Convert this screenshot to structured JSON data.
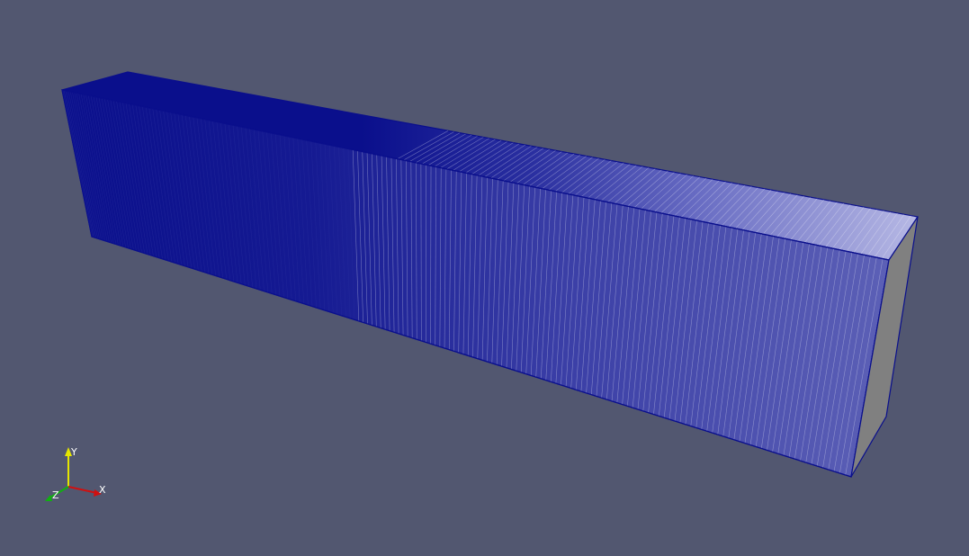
{
  "viewport": {
    "background_color": "#525770",
    "mesh_edge_color": "#0a0f8c",
    "mesh_face_color": "#ffffff",
    "end_face_color": "#808080",
    "representation": "surface-with-edges"
  },
  "orientation_axes": {
    "x": {
      "label": "X",
      "color": "#d01010"
    },
    "y": {
      "label": "Y",
      "color": "#e6e600"
    },
    "z": {
      "label": "Z",
      "color": "#10b010"
    }
  }
}
